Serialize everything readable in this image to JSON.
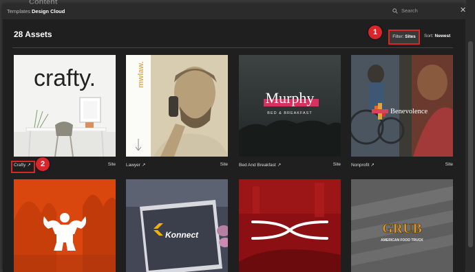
{
  "background": {
    "section_title": "Content"
  },
  "topbar": {
    "tabs": [
      {
        "label": "Templates"
      },
      {
        "label": "Design Cloud"
      }
    ],
    "search_placeholder": "Search"
  },
  "header": {
    "assets_count": "28 Assets",
    "filter_prefix": "Filter:",
    "filter_value": "Sites",
    "sort_prefix": "Sort:",
    "sort_value": "Newest"
  },
  "callouts": [
    {
      "number": "1"
    },
    {
      "number": "2"
    }
  ],
  "cards": [
    {
      "name": "Crafty",
      "type": "Site",
      "art_text": "crafty."
    },
    {
      "name": "Lawyer",
      "type": "Site",
      "art_text": "mwlaw."
    },
    {
      "name": "Bed And Breakfast",
      "type": "Site",
      "art_text": "Murphy",
      "art_subtext": "BED & BREAKFAST"
    },
    {
      "name": "Nonprofit",
      "type": "Site",
      "art_text": "Benevolence"
    },
    {
      "name": "",
      "type": ""
    },
    {
      "name": "",
      "type": "",
      "art_text": "Konnect"
    },
    {
      "name": "",
      "type": ""
    },
    {
      "name": "",
      "type": "",
      "art_text": "GRUB",
      "art_subtext": "AMERICAN FOOD TRUCK"
    }
  ],
  "colors": {
    "accent_red": "#d8262b",
    "window_bg": "#1f1f1f",
    "topbar_bg": "#2b2b2b"
  }
}
